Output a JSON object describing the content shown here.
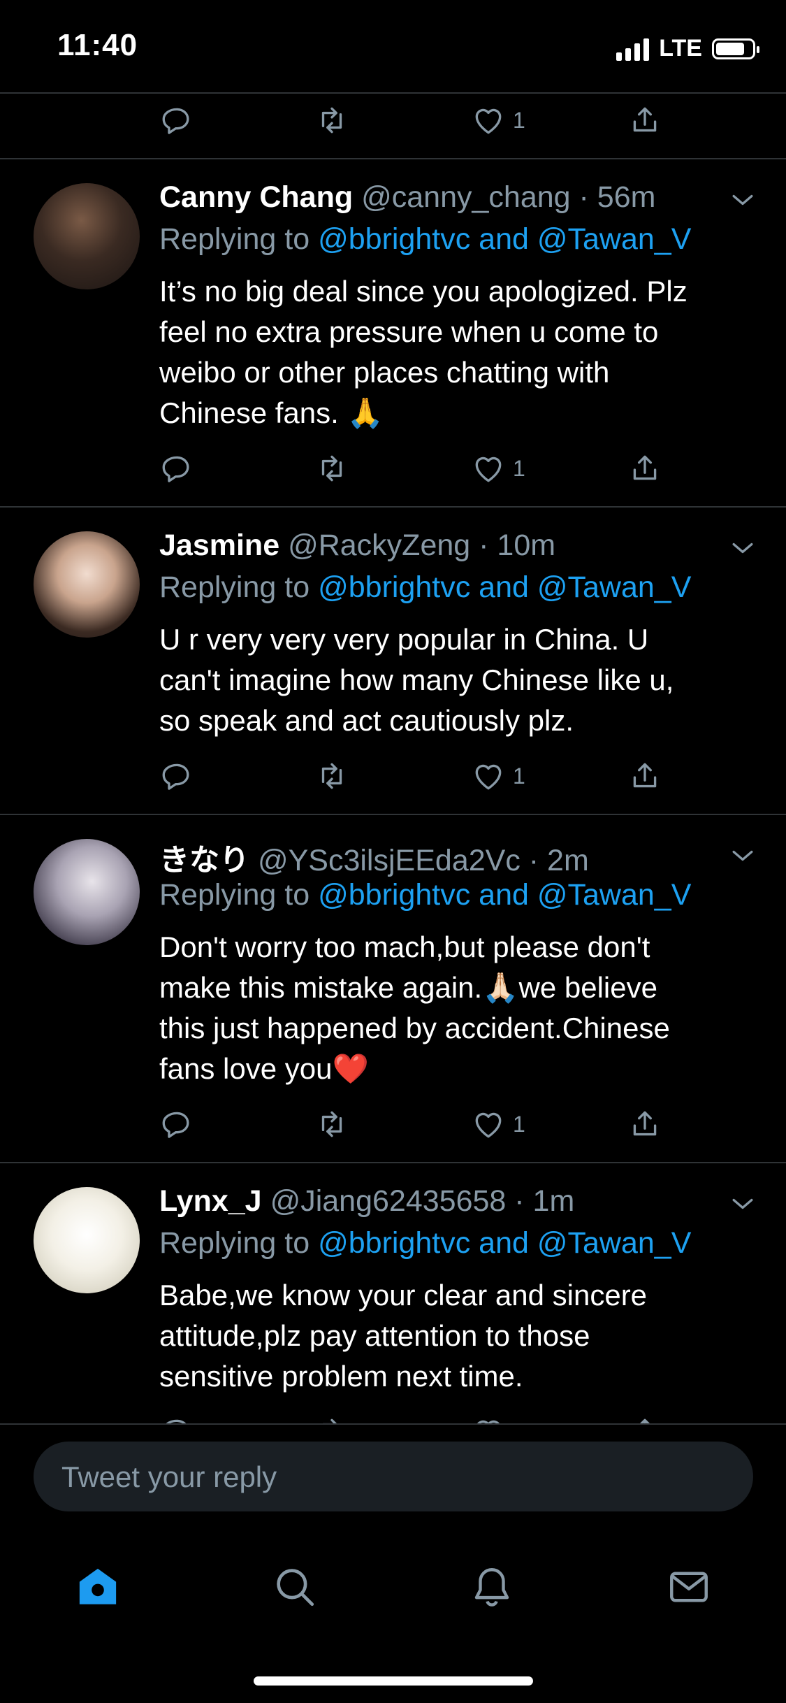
{
  "status_bar": {
    "time": "11:40",
    "network": "LTE",
    "battery_level": 0.8
  },
  "top_tweet_actions": {
    "likes": "1"
  },
  "tweets": [
    {
      "name": "Canny Chang",
      "handle": "@canny_chang",
      "time": "56m",
      "replying_label": "Replying to",
      "replying_to": "@bbrightvc and @Tawan_V",
      "lines": [
        "It’s no big deal since you apologized. Plz",
        "feel no extra pressure when u come to",
        "weibo or other places chatting with",
        "Chinese fans. 🙏"
      ],
      "likes": "1"
    },
    {
      "name": "Jasmine",
      "handle": "@RackyZeng",
      "time": "10m",
      "replying_label": "Replying to",
      "replying_to": "@bbrightvc and @Tawan_V",
      "lines": [
        "U r very very very popular in China. U",
        "can't imagine how many Chinese like u,",
        "so speak and act cautiously plz."
      ],
      "likes": "1"
    },
    {
      "name": "きなり",
      "handle": "@YSc3ilsjEEda2Vc",
      "time": "2m",
      "replying_label": "Replying to",
      "replying_to": "@bbrightvc and @Tawan_V",
      "lines": [
        "Don't worry too mach,but please don't",
        "make this mistake again.🙏🏻we believe",
        "this  just happened by accident.Chinese",
        "fans love you❤️"
      ],
      "likes": "1"
    },
    {
      "name": "Lynx_J",
      "handle": "@Jiang62435658",
      "time": "1m",
      "replying_label": "Replying to",
      "replying_to": "@bbrightvc and @Tawan_V",
      "lines": [
        "Babe,we know your clear and sincere",
        "attitude,plz pay attention to those",
        "sensitive problem next time."
      ],
      "likes": ""
    }
  ],
  "reply_box": {
    "placeholder": "Tweet your reply"
  },
  "bottom_nav": {
    "items": [
      {
        "icon": "home-icon",
        "active": true
      },
      {
        "icon": "search-icon",
        "active": false
      },
      {
        "icon": "bell-icon",
        "active": false
      },
      {
        "icon": "mail-icon",
        "active": false
      }
    ]
  },
  "colors": {
    "accent": "#1da1f2",
    "nav_active": "#1d9bf0",
    "muted": "#8899a6",
    "divider": "#2f3336",
    "background": "#000000"
  }
}
